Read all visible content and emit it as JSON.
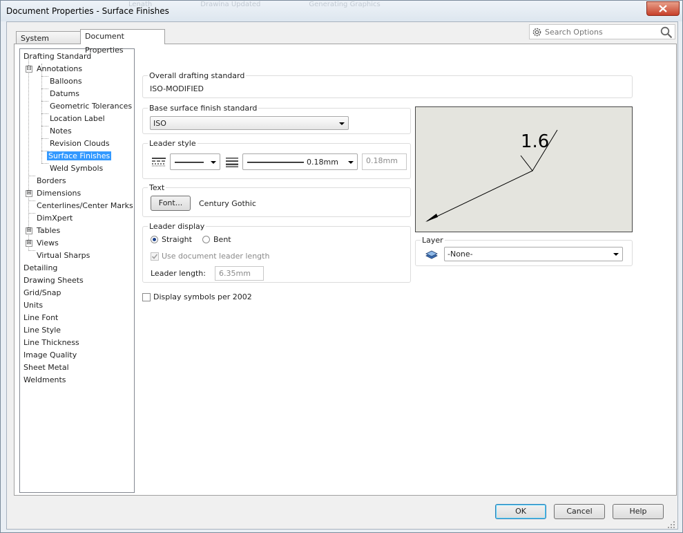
{
  "window": {
    "title": "Document Properties - Surface Finishes",
    "ghost_tabs": [
      "Lenath",
      "Drawina Updated",
      "Generating Graphics"
    ],
    "close_icon": "close-icon"
  },
  "tabs": [
    {
      "label": "System Options"
    },
    {
      "label": "Document Properties"
    }
  ],
  "search": {
    "placeholder": "Search Options",
    "gear_icon": "gear-icon",
    "search_icon": "search-icon"
  },
  "tree": {
    "items": [
      "Drafting Standard",
      "Annotations",
      "Balloons",
      "Datums",
      "Geometric Tolerances",
      "Location Label",
      "Notes",
      "Revision Clouds",
      "Surface Finishes",
      "Weld Symbols",
      "Borders",
      "Dimensions",
      "Centerlines/Center Marks",
      "DimXpert",
      "Tables",
      "Views",
      "Virtual Sharps",
      "Detailing",
      "Drawing Sheets",
      "Grid/Snap",
      "Units",
      "Line Font",
      "Line Style",
      "Line Thickness",
      "Image Quality",
      "Sheet Metal",
      "Weldments"
    ],
    "selected": "Surface Finishes",
    "expanded_marker": "⊟",
    "collapsed_marker": "⊞"
  },
  "overall": {
    "caption": "Overall drafting standard",
    "value": "ISO-MODIFIED"
  },
  "base_surface": {
    "caption": "Base surface finish standard",
    "value": "ISO"
  },
  "leader_style": {
    "caption": "Leader style",
    "thickness_value": "0.18mm",
    "custom_thickness": "0.18mm"
  },
  "text": {
    "caption": "Text",
    "font_button": "Font...",
    "font_name": "Century Gothic"
  },
  "leader_display": {
    "caption": "Leader display",
    "straight": "Straight",
    "bent": "Bent",
    "selected": "Straight",
    "use_doc_length": "Use document leader length",
    "leader_length_label": "Leader length:",
    "leader_length_value": "6.35mm"
  },
  "display_symbols": {
    "label": "Display symbols per 2002",
    "checked": false
  },
  "preview": {
    "value_label": "1.6"
  },
  "layer": {
    "caption": "Layer",
    "value": "-None-"
  },
  "buttons": {
    "ok": "OK",
    "cancel": "Cancel",
    "help": "Help"
  },
  "colors": {
    "selection": "#3399ff",
    "preview_bg": "#e4e4de",
    "close": "#c7402b"
  }
}
